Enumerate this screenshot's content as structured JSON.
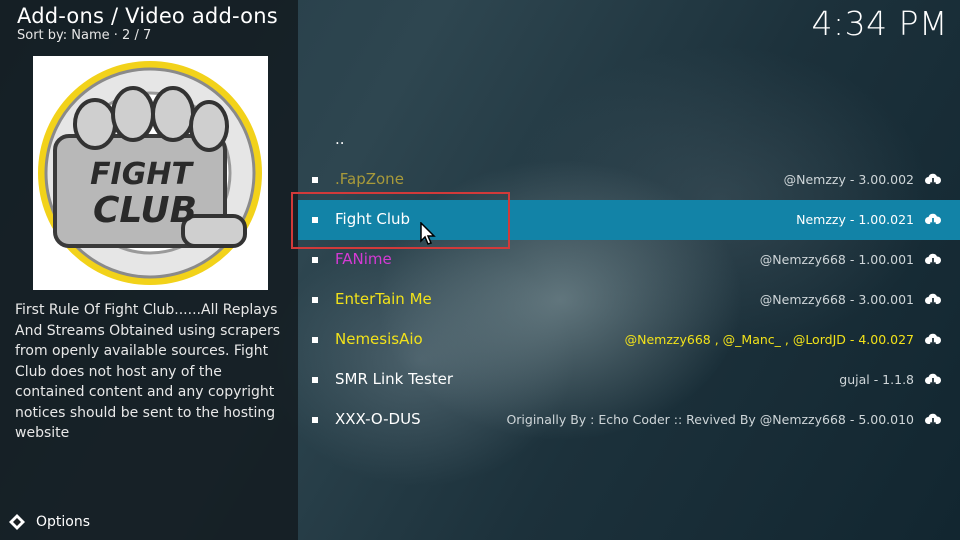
{
  "header": {
    "title": "Add-ons / Video add-ons",
    "sort_info": "Sort by: Name  ·  2 / 7",
    "clock": "4:34 PM"
  },
  "addon_preview": {
    "logo_text_line1": "FIGHT",
    "logo_text_line2": "CLUB",
    "description": "First Rule Of Fight Club......All Replays And Streams Obtained using scrapers from openly available sources. Fight Club does not host any of the contained content and any copyright notices should be sent to the hosting website"
  },
  "footer": {
    "options_label": "Options"
  },
  "list": {
    "parent_label": "..",
    "items": [
      {
        "name": ".FapZone",
        "meta": "@Nemzzy - 3.00.002",
        "name_color": "#a89a3a",
        "meta_color": "#cfd6d9"
      },
      {
        "name": "Fight Club",
        "meta": "Nemzzy - 1.00.021",
        "name_color": "#ffffff",
        "meta_color": "#ffffff",
        "selected": true
      },
      {
        "name": "FANime",
        "meta": "@Nemzzy668 - 1.00.001",
        "name_color": "#d43ad4",
        "meta_color": "#cfd6d9"
      },
      {
        "name": "EnterTain Me",
        "meta": "@Nemzzy668 - 3.00.001",
        "name_color": "#f2e21a",
        "meta_color": "#cfd6d9"
      },
      {
        "name": "NemesisAio",
        "meta": "@Nemzzy668 , @_Manc_ , @LordJD - 4.00.027",
        "name_color": "#f2e21a",
        "meta_color": "#f2e21a"
      },
      {
        "name": "SMR Link Tester",
        "meta": "gujal - 1.1.8",
        "name_color": "#ffffff",
        "meta_color": "#cfd6d9"
      },
      {
        "name": "XXX-O-DUS",
        "meta": "Originally By : Echo Coder :: Revived By @Nemzzy668 - 5.00.010",
        "name_color": "#ffffff",
        "meta_color": "#cfd6d9"
      }
    ]
  },
  "icons": {
    "download": "cloud-download-icon",
    "options": "options-diamond-icon",
    "cursor": "mouse-pointer-icon"
  },
  "colors": {
    "selection": "#1283a7",
    "highlight_box": "#d23a3a"
  }
}
